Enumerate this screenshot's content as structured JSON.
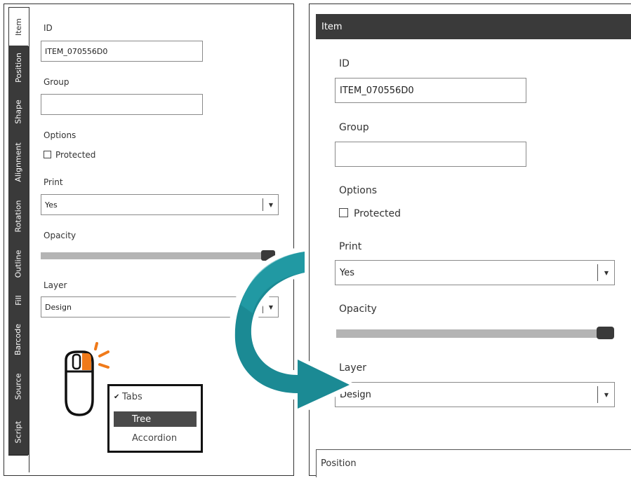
{
  "left_panel": {
    "tabs": [
      "Item",
      "Position",
      "Shape",
      "Alignment",
      "Rotation",
      "Outline",
      "Fill",
      "Barcode",
      "Source",
      "Script"
    ],
    "id_label": "ID",
    "id_value": "ITEM_070556D0",
    "group_label": "Group",
    "group_value": "",
    "options_label": "Options",
    "protected_label": "Protected",
    "print_label": "Print",
    "print_value": "Yes",
    "opacity_label": "Opacity",
    "opacity_level": 1.0,
    "layer_label": "Layer",
    "layer_value": "Design"
  },
  "context_menu": {
    "items": [
      "Tabs",
      "Tree",
      "Accordion"
    ],
    "checked": "Tabs",
    "highlighted": "Tree"
  },
  "right_panel": {
    "section_title": "Item",
    "id_label": "ID",
    "id_value": "ITEM_070556D0",
    "group_label": "Group",
    "group_value": "",
    "options_label": "Options",
    "protected_label": "Protected",
    "print_label": "Print",
    "print_value": "Yes",
    "opacity_label": "Opacity",
    "opacity_level": 1.0,
    "layer_label": "Layer",
    "layer_value": "Design",
    "next_section_title": "Position"
  },
  "icons": {
    "checkmark": "✔",
    "dropdown": "▼"
  },
  "colors": {
    "tab_bg": "#3a3a3a",
    "header_bg": "#3a3a3a",
    "arrow_teal": "#1b8a94",
    "mouse_orange": "#f07a1a",
    "menu_highlight": "#4a4a4a"
  }
}
